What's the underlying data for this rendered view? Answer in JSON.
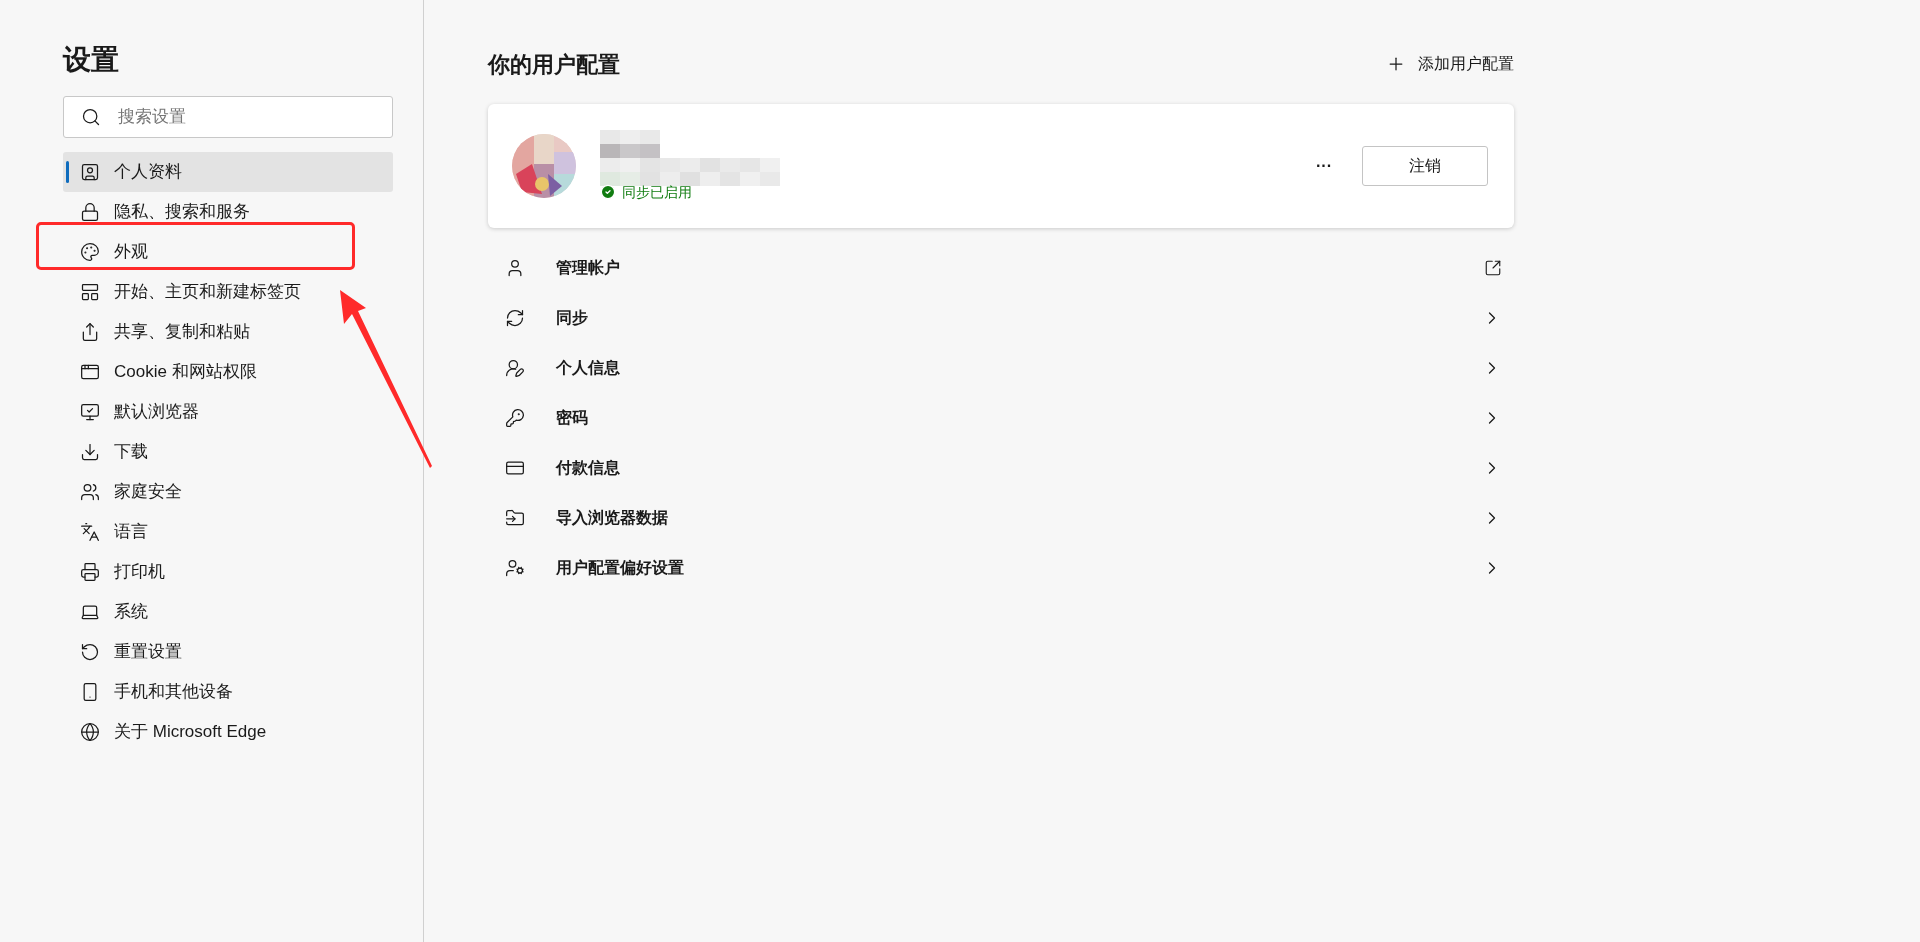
{
  "sidebar": {
    "title": "设置",
    "search": {
      "placeholder": "搜索设置"
    },
    "items": [
      {
        "label": "个人资料",
        "selected": true,
        "highlighted": false
      },
      {
        "label": "隐私、搜索和服务",
        "selected": false,
        "highlighted": false
      },
      {
        "label": "外观",
        "selected": false,
        "highlighted": true
      },
      {
        "label": "开始、主页和新建标签页",
        "selected": false,
        "highlighted": false
      },
      {
        "label": "共享、复制和粘贴",
        "selected": false,
        "highlighted": false
      },
      {
        "label": "Cookie 和网站权限",
        "selected": false,
        "highlighted": false
      },
      {
        "label": "默认浏览器",
        "selected": false,
        "highlighted": false
      },
      {
        "label": "下载",
        "selected": false,
        "highlighted": false
      },
      {
        "label": "家庭安全",
        "selected": false,
        "highlighted": false
      },
      {
        "label": "语言",
        "selected": false,
        "highlighted": false
      },
      {
        "label": "打印机",
        "selected": false,
        "highlighted": false
      },
      {
        "label": "系统",
        "selected": false,
        "highlighted": false
      },
      {
        "label": "重置设置",
        "selected": false,
        "highlighted": false
      },
      {
        "label": "手机和其他设备",
        "selected": false,
        "highlighted": false
      },
      {
        "label": "关于 Microsoft Edge",
        "selected": false,
        "highlighted": false
      }
    ]
  },
  "main": {
    "title": "你的用户配置",
    "add_button": "添加用户配置",
    "profile": {
      "sync_status": "同步已启用",
      "more_button": "···",
      "sign_out_button": "注销"
    },
    "rows": [
      {
        "label": "管理帐户",
        "kind": "external"
      },
      {
        "label": "同步",
        "kind": "chevron"
      },
      {
        "label": "个人信息",
        "kind": "chevron"
      },
      {
        "label": "密码",
        "kind": "chevron"
      },
      {
        "label": "付款信息",
        "kind": "chevron"
      },
      {
        "label": "导入浏览器数据",
        "kind": "chevron"
      },
      {
        "label": "用户配置偏好设置",
        "kind": "chevron"
      }
    ]
  }
}
